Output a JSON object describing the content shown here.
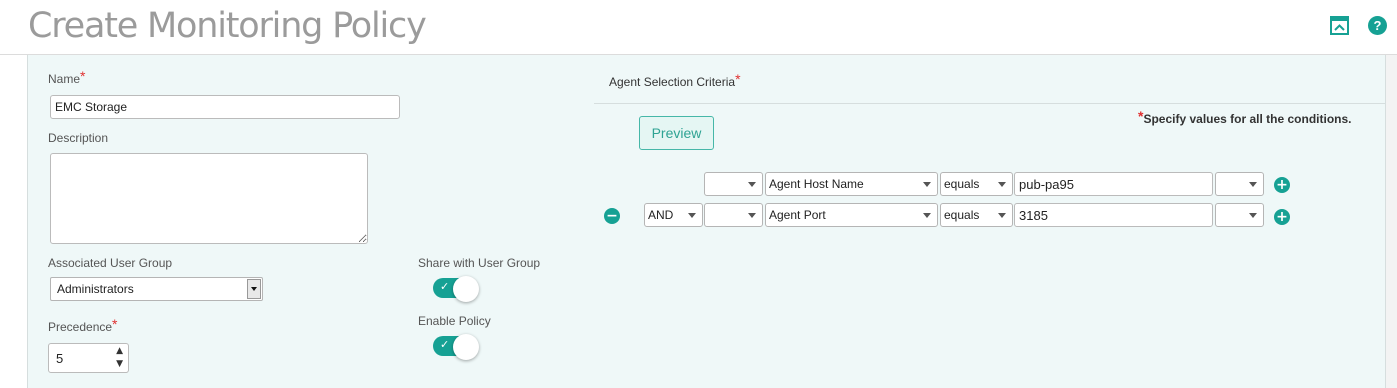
{
  "header": {
    "title": "Create Monitoring Policy",
    "collapse_icon": "collapse-panel-icon",
    "help_icon": "help-icon",
    "help_label": "?",
    "accent": "#16a194"
  },
  "form": {
    "name_label": "Name",
    "name_value": "EMC Storage",
    "required_mark": "*",
    "description_label": "Description",
    "description_value": "",
    "user_group_label": "Associated User Group",
    "user_group_value": "Administrators",
    "share_label": "Share with User Group",
    "share_enabled": true,
    "precedence_label": "Precedence",
    "precedence_value": "5",
    "enable_label": "Enable Policy",
    "enable_enabled": true
  },
  "criteria": {
    "title": "Agent Selection Criteria",
    "note": "Specify values for all the conditions.",
    "preview_label": "Preview",
    "rows": [
      {
        "logic": "",
        "paren_open": "",
        "field": "Agent Host Name",
        "operator": "equals",
        "value": "pub-pa95",
        "paren_close": ""
      },
      {
        "logic": "AND",
        "paren_open": "",
        "field": "Agent Port",
        "operator": "equals",
        "value": "3185",
        "paren_close": ""
      }
    ]
  }
}
